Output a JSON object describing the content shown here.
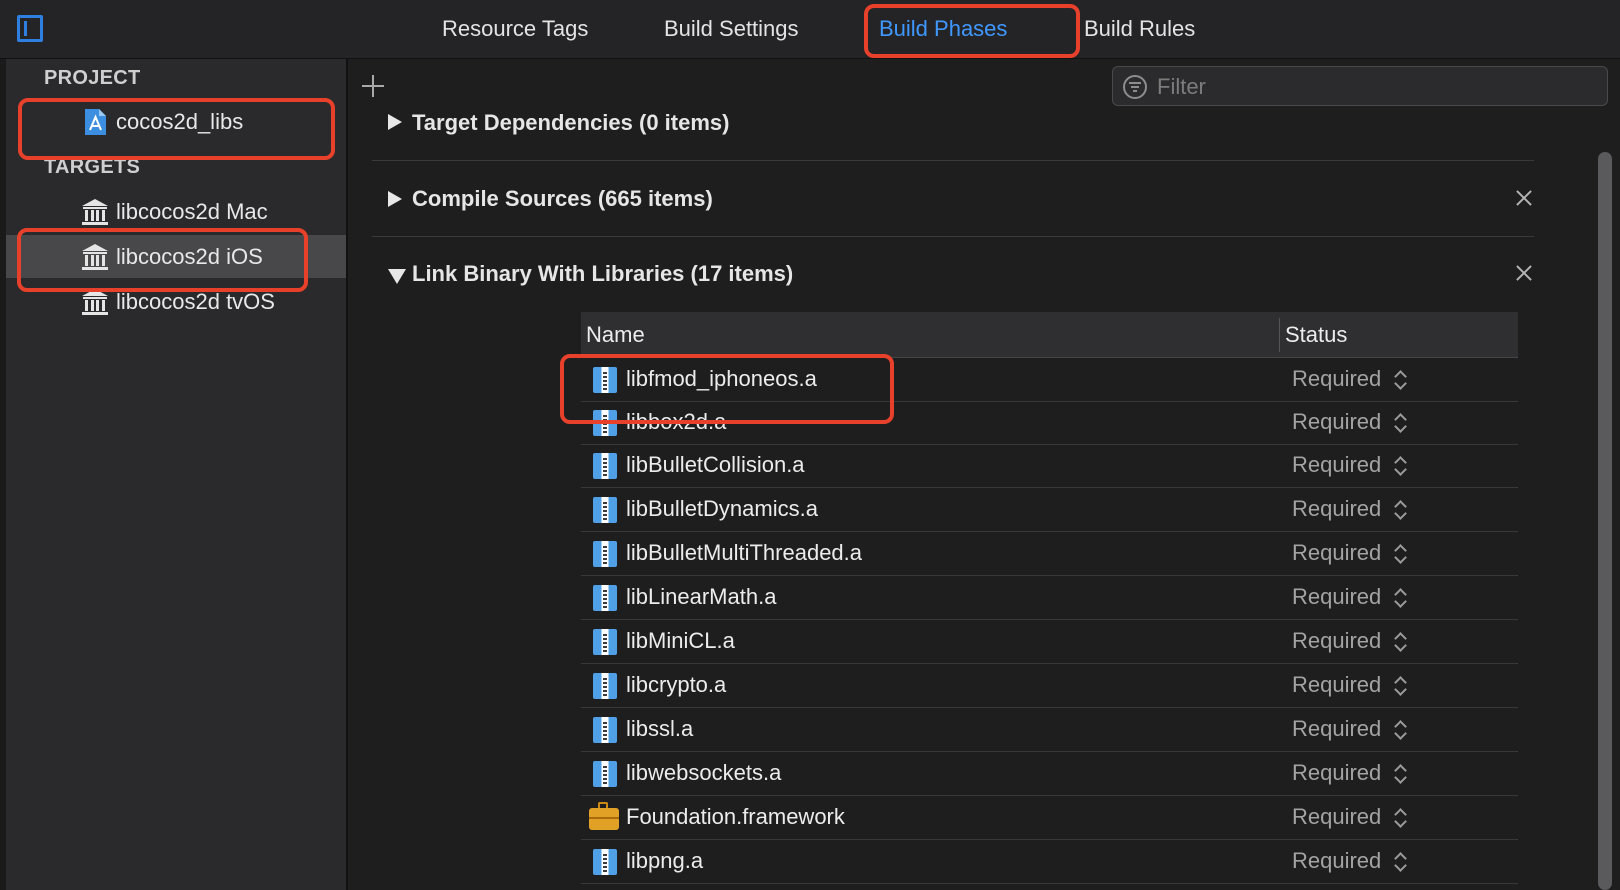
{
  "tabs": [
    {
      "label": "Resource Tags"
    },
    {
      "label": "Build Settings"
    },
    {
      "label": "Build Phases"
    },
    {
      "label": "Build Rules"
    }
  ],
  "sidebar": {
    "project_header": "PROJECT",
    "project_item": "cocos2d_libs",
    "targets_header": "TARGETS",
    "targets": [
      {
        "label": "libcocos2d Mac"
      },
      {
        "label": "libcocos2d iOS"
      },
      {
        "label": "libcocos2d tvOS"
      }
    ]
  },
  "filter": {
    "placeholder": "Filter",
    "value": ""
  },
  "phases": [
    {
      "title": "Target Dependencies (0 items)",
      "expanded": false
    },
    {
      "title": "Compile Sources (665 items)",
      "expanded": false
    },
    {
      "title": "Link Binary With Libraries (17 items)",
      "expanded": true
    }
  ],
  "table": {
    "col_name": "Name",
    "col_status": "Status",
    "rows": [
      {
        "name": "libfmod_iphoneos.a",
        "status": "Required",
        "icon": "static-library-icon"
      },
      {
        "name": "libbox2d.a",
        "status": "Required",
        "icon": "static-library-icon"
      },
      {
        "name": "libBulletCollision.a",
        "status": "Required",
        "icon": "static-library-icon"
      },
      {
        "name": "libBulletDynamics.a",
        "status": "Required",
        "icon": "static-library-icon"
      },
      {
        "name": "libBulletMultiThreaded.a",
        "status": "Required",
        "icon": "static-library-icon"
      },
      {
        "name": "libLinearMath.a",
        "status": "Required",
        "icon": "static-library-icon"
      },
      {
        "name": "libMiniCL.a",
        "status": "Required",
        "icon": "static-library-icon"
      },
      {
        "name": "libcrypto.a",
        "status": "Required",
        "icon": "static-library-icon"
      },
      {
        "name": "libssl.a",
        "status": "Required",
        "icon": "static-library-icon"
      },
      {
        "name": "libwebsockets.a",
        "status": "Required",
        "icon": "static-library-icon"
      },
      {
        "name": "Foundation.framework",
        "status": "Required",
        "icon": "framework-toolbox-icon"
      },
      {
        "name": "libpng.a",
        "status": "Required",
        "icon": "static-library-icon"
      }
    ]
  },
  "colors": {
    "accent": "#3f98ff",
    "annotation": "#e8412b",
    "background": "#1e1e1f",
    "sidebar": "#2a2a2c",
    "selection": "#48484b"
  }
}
